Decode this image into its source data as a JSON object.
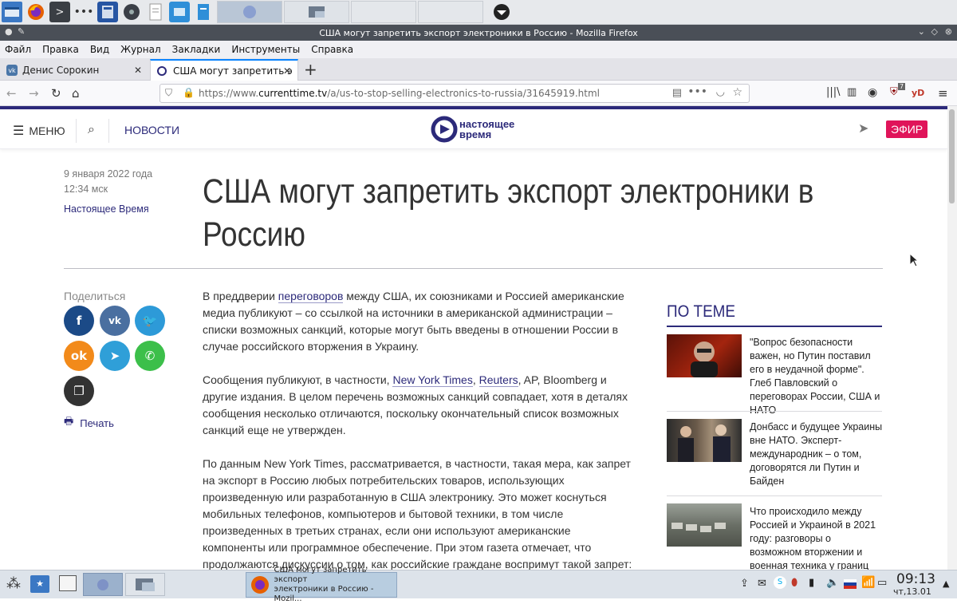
{
  "browser": {
    "window_title": "США могут запретить экспорт электроники в Россию - Mozilla Firefox",
    "menu": [
      "Файл",
      "Правка",
      "Вид",
      "Журнал",
      "Закладки",
      "Инструменты",
      "Справка"
    ],
    "tabs": [
      {
        "label": "Денис Сорокин",
        "active": false
      },
      {
        "label": "США могут запретить э",
        "active": true
      }
    ],
    "url_prefix": "https://www.",
    "url_host": "currenttime.tv",
    "url_path": "/a/us-to-stop-selling-electronics-to-russia/31645919.html",
    "ublock_count": "7",
    "yd_label": "yD"
  },
  "site": {
    "menu_label": "МЕНЮ",
    "news_label": "НОВОСТИ",
    "logo_line1": "настоящее",
    "logo_line2": "время",
    "live_label": "ЭФИР"
  },
  "article": {
    "date": "9 января 2022 года",
    "time": "12:34 мск",
    "author": "Настоящее Время",
    "title": "США могут запретить экспорт электроники в Россию",
    "share_label": "Поделиться",
    "print_label": "Печать",
    "p1": {
      "a": "В преддверии ",
      "link": "переговоров",
      "b": " между США, их союзниками и Россией американские медиа публикуют – со ссылкой на источники в американской администрации – списки возможных санкций, которые могут быть введены в отношении России в случае российского вторжения в Украину."
    },
    "p2": {
      "a": "Сообщения публикуют, в частности, ",
      "link1": "New York Times",
      "sep": ", ",
      "link2": "Reuters",
      "b": ", AP, Bloomberg и другие издания. В целом перечень возможных санкций совпадает, хотя в деталях сообщения несколько отличаются, поскольку окончательный список возможных санкций еще не утвержден."
    },
    "p3": "По данным New York Times, рассматривается, в частности, такая мера, как запрет на экспорт в Россию любых потребительских товаров, использующих произведенную или разработанную в США электронику. Это может коснуться мобильных телефонов, компьютеров и бытовой техники, в том числе произведенных в третьих странах, если они используют американские компоненты или программное обеспечение. При этом газета отмечает, что продолжаются дискуссии о том, как российские граждане воспримут такой запрет: возложат ли они за него ответственность на Путина или же"
  },
  "related": {
    "heading": "ПО ТЕМЕ",
    "items": [
      {
        "text": "\"Вопрос безопасности важен, но Путин поставил его в неудачной форме\". Глеб Павловский о переговорах России, США и НАТО"
      },
      {
        "text": "Донбасс и будущее Украины вне НАТО. Эксперт-международник – о том, договорятся ли Путин и Байден"
      },
      {
        "text": "Что происходило между Россией и Украиной в 2021 году: разговоры о возможном вторжении и военная техника у границ"
      }
    ]
  },
  "taskbar": {
    "window_label_line1": "США могут запретить экспорт",
    "window_label_line2": "электроники в Россию - Mozil...",
    "clock_time": "09:13",
    "clock_date": "чт,13.01"
  },
  "colors": {
    "brand": "#2c2a7a",
    "live": "#e0145a",
    "facebook": "#1b4a87",
    "vk": "#4a6fa0",
    "twitter": "#2d9ad8",
    "ok": "#f28a1a",
    "telegram": "#2f9fd8",
    "whatsapp": "#3cbf4a",
    "copy": "#333333"
  },
  "icons": [
    "firefox-icon",
    "terminal-icon",
    "file-manager-icon",
    "reader-view-icon",
    "pocket-icon",
    "bookmark-star-icon",
    "library-icon",
    "sidebar-icon",
    "account-icon",
    "ublock-icon",
    "hamburger-menu-icon",
    "telegram-icon",
    "search-icon",
    "printer-icon"
  ]
}
